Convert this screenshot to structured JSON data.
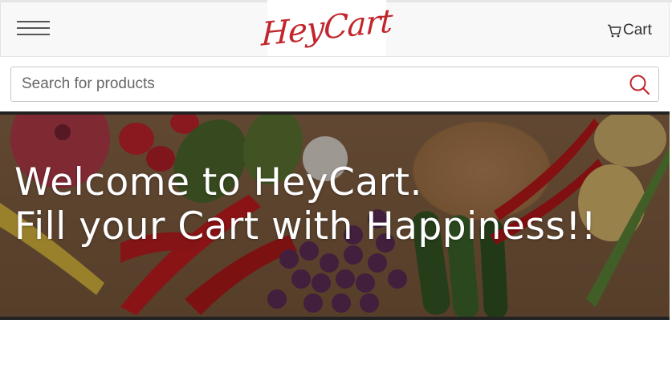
{
  "header": {
    "brand": "HeyCart",
    "cart_label": "Cart",
    "menu_icon": "hamburger-menu-icon",
    "cart_icon": "shopping-cart-icon",
    "brand_color": "#c0272d"
  },
  "search": {
    "placeholder": "Search for products",
    "value": "",
    "icon": "search-icon",
    "icon_color": "#c0272d"
  },
  "hero": {
    "line1": "Welcome to HeyCart.",
    "line2": "Fill your Cart with Happiness!!"
  }
}
